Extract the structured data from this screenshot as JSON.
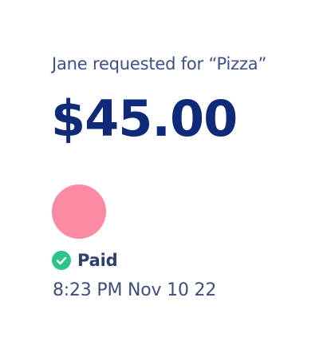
{
  "request": {
    "text": "Jane requested for “Pizza”"
  },
  "amount": {
    "display": "$45.00"
  },
  "payer": {
    "avatar_color": "#fb8aa3"
  },
  "status": {
    "icon": "check-circle-icon",
    "icon_color": "#2cc48b",
    "label": "Paid"
  },
  "timestamp": "8:23 PM Nov 10 22",
  "colors": {
    "amount_text": "#0f2a78",
    "body_text": "#3f4f8c"
  }
}
